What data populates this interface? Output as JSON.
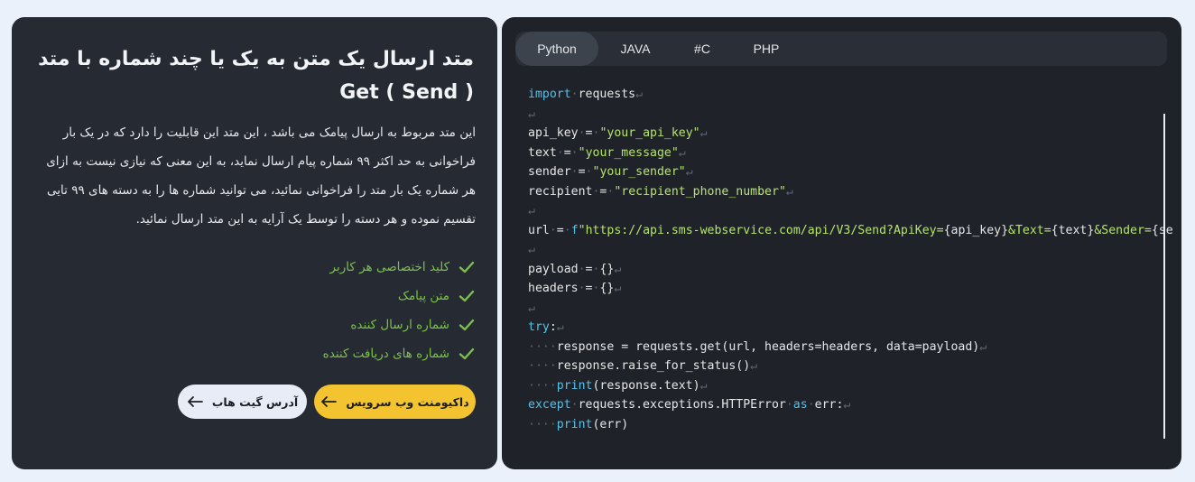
{
  "left": {
    "title": "متد ارسال یک متن به یک یا چند شماره با متد Get ( Send )",
    "description": "این متد مربوط به ارسال پیامک می باشد ، این متد این قابلیت را دارد که در یک بار فراخوانی به حد اکثر ۹۹ شماره پیام ارسال نماید، به این معنی که نیازی نیست به ازای هر شماره یک بار متد را فراخوانی نمائید، می توانید شماره ها را به دسته های ۹۹ تایی تقسیم نموده و هر دسته را توسط یک آرایه به این متد ارسال نمائید.",
    "features": [
      "کلید اختصاصی هر کاربر",
      "متن پیامک",
      "شماره ارسال کننده",
      "شماره های دریافت کننده"
    ],
    "buttons": {
      "docs": "داکیومنت وب سرویس",
      "github": "آدرس گیت هاب"
    },
    "icons": {
      "check": "check-icon",
      "arrow": "arrow-left-icon"
    },
    "colors": {
      "accent": "#f4c430",
      "check": "#7cc04a"
    }
  },
  "right": {
    "tabs": [
      "Python",
      "JAVA",
      "#C",
      "PHP"
    ],
    "active_tab": "Python",
    "code": {
      "import": "import",
      "requests_mod": "requests",
      "api_key_var": "api_key",
      "api_key_val": "\"your_api_key\"",
      "text_var": "text",
      "text_val": "\"your_message\"",
      "sender_var": "sender",
      "sender_val": "\"your_sender\"",
      "recipient_var": "recipient",
      "recipient_val": "\"recipient_phone_number\"",
      "url_var": "url",
      "url_f": "f",
      "url_s1": "\"https://api.sms-webservice.com/api/V3/Send?ApiKey=",
      "url_e1": "{api_key}",
      "url_s2": "&Text=",
      "url_e2": "{text}",
      "url_s3": "&Sender=",
      "url_e3": "{se",
      "payload": "payload",
      "headers": "headers",
      "empty_dict": "{}",
      "try_kw": "try",
      "get_line": "response = requests.get(url, headers=headers, data=payload)",
      "raise_line": "response.raise_for_status()",
      "print_kw": "print",
      "print_arg1": "(response.text)",
      "except_kw": "except",
      "except_mid": "requests.exceptions.HTTPError",
      "as_kw": "as",
      "err_colon": "err:",
      "print_arg2": "(err)"
    }
  }
}
